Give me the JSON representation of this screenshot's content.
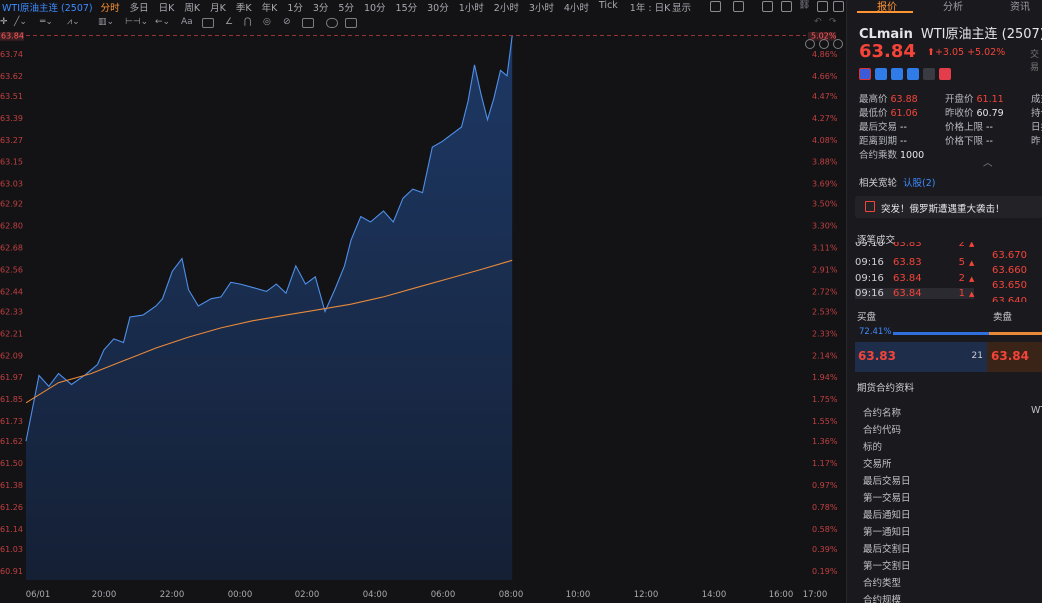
{
  "toolbar": {
    "symbol": "WTI原油主连 (2507)",
    "timeframes": [
      "分时",
      "多日",
      "日K",
      "周K",
      "月K",
      "季K",
      "年K",
      "1分",
      "3分",
      "5分",
      "10分",
      "15分",
      "30分",
      "1小时",
      "2小时",
      "3小时",
      "4小时",
      "Tick"
    ],
    "active_timeframe": "分时",
    "range_label": "1年 : 日K",
    "display_label": "显示"
  },
  "drawing_tools": {
    "text_tool_label": "Aa"
  },
  "chart_data": {
    "type": "line",
    "x_tick_labels": [
      "06/01",
      "20:00",
      "22:00",
      "00:00",
      "02:00",
      "04:00",
      "06:00",
      "08:00",
      "10:00",
      "12:00",
      "14:00",
      "16:00",
      "17:00"
    ],
    "y_tick_labels": [
      "63.74",
      "63.62",
      "63.51",
      "63.39",
      "63.27",
      "63.15",
      "63.03",
      "62.92",
      "62.80",
      "62.68",
      "62.56",
      "62.44",
      "62.33",
      "62.21",
      "62.09",
      "61.97",
      "61.85",
      "61.73",
      "61.62",
      "61.50",
      "61.38",
      "61.26",
      "61.14",
      "61.03",
      "60.91"
    ],
    "y_pct_labels": [
      "4.86%",
      "4.66%",
      "4.47%",
      "4.27%",
      "4.08%",
      "3.88%",
      "3.69%",
      "3.50%",
      "3.30%",
      "3.11%",
      "2.91%",
      "2.72%",
      "2.53%",
      "2.33%",
      "2.14%",
      "1.94%",
      "1.75%",
      "1.55%",
      "1.36%",
      "1.17%",
      "0.97%",
      "0.78%",
      "0.58%",
      "0.39%",
      "0.19%"
    ],
    "y_ticks": [
      63.74,
      63.62,
      63.51,
      63.39,
      63.27,
      63.15,
      63.03,
      62.92,
      62.8,
      62.68,
      62.56,
      62.44,
      62.33,
      62.21,
      62.09,
      61.97,
      61.85,
      61.73,
      61.62,
      61.5,
      61.38,
      61.26,
      61.14,
      61.03,
      60.91
    ],
    "ylim": [
      60.86,
      63.86
    ],
    "current_price_label": "63.84",
    "current_pct_label": "5.02%",
    "current_value": 63.84,
    "series": [
      {
        "color": "#4f8fe8",
        "points": [
          [
            0,
            61.62
          ],
          [
            0.2,
            61.98
          ],
          [
            0.35,
            61.92
          ],
          [
            0.5,
            61.99
          ],
          [
            0.7,
            61.93
          ],
          [
            0.9,
            61.98
          ],
          [
            1.1,
            62.04
          ],
          [
            1.2,
            62.12
          ],
          [
            1.35,
            62.18
          ],
          [
            1.5,
            62.16
          ],
          [
            1.6,
            62.3
          ],
          [
            1.8,
            62.31
          ],
          [
            2.0,
            62.36
          ],
          [
            2.1,
            62.4
          ],
          [
            2.25,
            62.55
          ],
          [
            2.4,
            62.62
          ],
          [
            2.5,
            62.45
          ],
          [
            2.65,
            62.36
          ],
          [
            2.85,
            62.4
          ],
          [
            3.0,
            62.41
          ],
          [
            3.15,
            62.49
          ],
          [
            3.3,
            62.48
          ],
          [
            3.5,
            62.46
          ],
          [
            3.7,
            62.44
          ],
          [
            3.85,
            62.48
          ],
          [
            4.0,
            62.43
          ],
          [
            4.15,
            62.58
          ],
          [
            4.3,
            62.48
          ],
          [
            4.45,
            62.52
          ],
          [
            4.6,
            62.33
          ],
          [
            4.75,
            62.45
          ],
          [
            4.9,
            62.58
          ],
          [
            5.0,
            62.72
          ],
          [
            5.15,
            62.85
          ],
          [
            5.3,
            62.82
          ],
          [
            5.5,
            62.88
          ],
          [
            5.65,
            62.82
          ],
          [
            5.8,
            62.95
          ],
          [
            5.95,
            63.0
          ],
          [
            6.1,
            62.98
          ],
          [
            6.25,
            63.23
          ],
          [
            6.4,
            63.26
          ],
          [
            6.55,
            63.3
          ],
          [
            6.7,
            63.34
          ],
          [
            6.8,
            63.48
          ],
          [
            6.9,
            63.68
          ],
          [
            7.0,
            63.52
          ],
          [
            7.1,
            63.38
          ],
          [
            7.2,
            63.5
          ],
          [
            7.3,
            63.65
          ],
          [
            7.4,
            63.62
          ],
          [
            7.48,
            63.84
          ]
        ]
      },
      {
        "color": "#e8893a",
        "points": [
          [
            0,
            61.83
          ],
          [
            0.5,
            61.94
          ],
          [
            1.0,
            61.99
          ],
          [
            1.5,
            62.06
          ],
          [
            2.0,
            62.13
          ],
          [
            2.5,
            62.19
          ],
          [
            3.0,
            62.24
          ],
          [
            3.5,
            62.28
          ],
          [
            4.0,
            62.31
          ],
          [
            4.5,
            62.34
          ],
          [
            5.0,
            62.37
          ],
          [
            5.5,
            62.41
          ],
          [
            6.0,
            62.46
          ],
          [
            6.5,
            62.51
          ],
          [
            7.0,
            62.56
          ],
          [
            7.48,
            62.61
          ]
        ]
      }
    ],
    "xlim": [
      0,
      12
    ]
  },
  "quote": {
    "tabs": [
      "报价",
      "分析",
      "资讯"
    ],
    "active_tab": "报价",
    "symbol_code": "CLmain",
    "symbol_name": "WTI原油主连 (2507)",
    "last_price": "63.84",
    "change": "+3.05 +5.02%",
    "exchange_label": "交易",
    "stats": [
      {
        "label": "最高价",
        "value": "63.88",
        "color": "red"
      },
      {
        "label": "最低价",
        "value": "61.06",
        "color": "red"
      },
      {
        "label": "最后交易",
        "value": "--",
        "color": "white"
      },
      {
        "label": "距离到期",
        "value": "--",
        "color": "white"
      },
      {
        "label": "合约乘数",
        "value": "1000",
        "color": "white"
      }
    ],
    "stats2": [
      {
        "label": "开盘价",
        "value": "61.11",
        "color": "red"
      },
      {
        "label": "昨收价",
        "value": "60.79",
        "color": "white"
      },
      {
        "label": "价格上限",
        "value": "--",
        "color": "white"
      },
      {
        "label": "价格下限",
        "value": "--",
        "color": "white"
      }
    ],
    "stats3": [
      "成交",
      "持仓",
      "日持",
      "昨"
    ],
    "related_label": "相关宽轮",
    "related_link": "认股(2)",
    "news_headline": "突发！俄罗斯遭遇重大袭击！",
    "trades_title": "逐笔成交",
    "trades": [
      {
        "time": "09:16",
        "price": "63.83",
        "qty": "2",
        "highlight": false
      },
      {
        "time": "09:16",
        "price": "63.83",
        "qty": "5",
        "highlight": false
      },
      {
        "time": "09:16",
        "price": "63.84",
        "qty": "2",
        "highlight": false
      },
      {
        "time": "09:16",
        "price": "63.84",
        "qty": "1",
        "highlight": true
      }
    ],
    "book_prices": [
      "63.670",
      "63.660",
      "63.650",
      "63.640"
    ],
    "bid_label": "买盘",
    "ask_label": "卖盘",
    "bid_pct": "72.41%",
    "bid_price": "63.83",
    "bid_qty": "21",
    "ask_price": "63.84",
    "contract_title": "期货合约资料",
    "contract_fields": [
      "合约名称",
      "合约代码",
      "标的",
      "交易所",
      "最后交易日",
      "第一交易日",
      "最后通知日",
      "第一通知日",
      "最后交割日",
      "第一交割日",
      "合约类型",
      "合约规模"
    ],
    "contract_name_value": "WT"
  }
}
